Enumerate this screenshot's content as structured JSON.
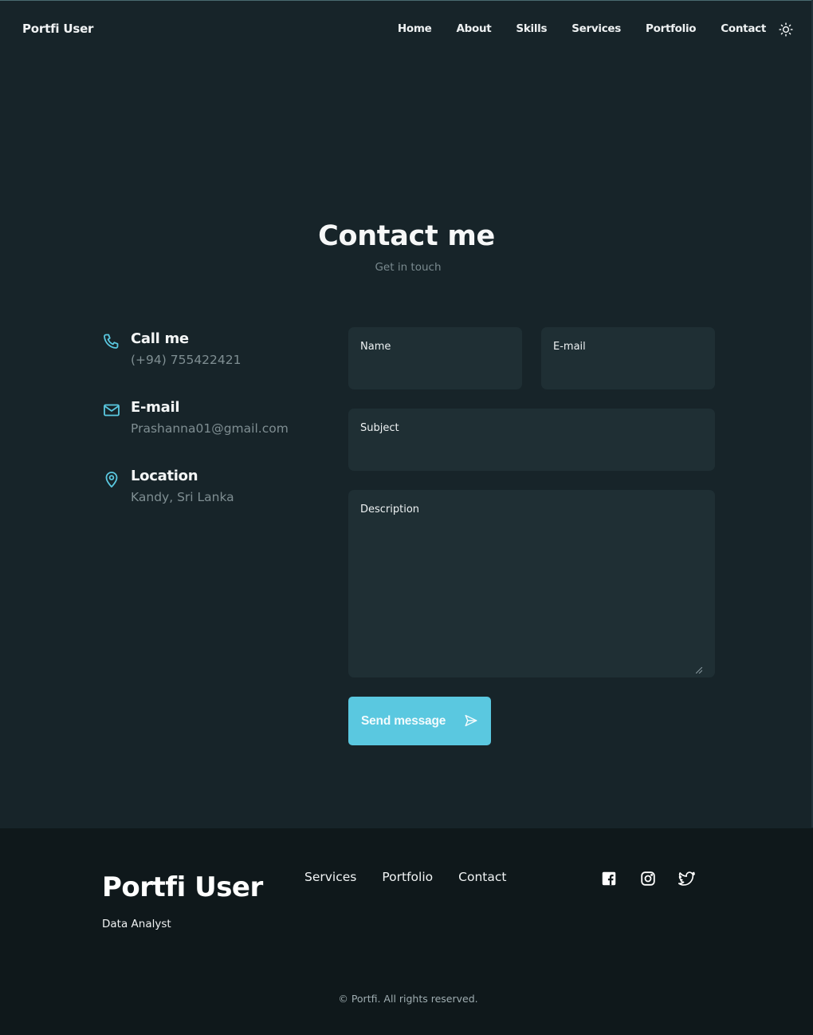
{
  "header": {
    "logo": "Portfi User",
    "nav": [
      "Home",
      "About",
      "Skills",
      "Services",
      "Portfolio",
      "Contact"
    ],
    "theme_icon": "sun-icon"
  },
  "section": {
    "title": "Contact me",
    "subtitle": "Get in touch"
  },
  "contact_info": [
    {
      "icon": "phone-icon",
      "label": "Call me",
      "value": "(+94) 755422421"
    },
    {
      "icon": "mail-icon",
      "label": "E-mail",
      "value": "Prashanna01@gmail.com"
    },
    {
      "icon": "location-pin-icon",
      "label": "Location",
      "value": "Kandy, Sri Lanka"
    }
  ],
  "form": {
    "name_label": "Name",
    "email_label": "E-mail",
    "subject_label": "Subject",
    "description_label": "Description",
    "submit_label": "Send message",
    "submit_icon": "send-icon"
  },
  "footer": {
    "brand": "Portfi User",
    "role": "Data Analyst",
    "links": [
      "Services",
      "Portfolio",
      "Contact"
    ],
    "social": [
      "facebook-icon",
      "instagram-icon",
      "twitter-icon"
    ],
    "copyright": "© Portfi. All rights reserved."
  },
  "colors": {
    "background": "#172429",
    "footer_background": "#0f181b",
    "field_background": "#1f2f34",
    "accent": "#5ac8e0",
    "muted_text": "#7f8e92"
  }
}
